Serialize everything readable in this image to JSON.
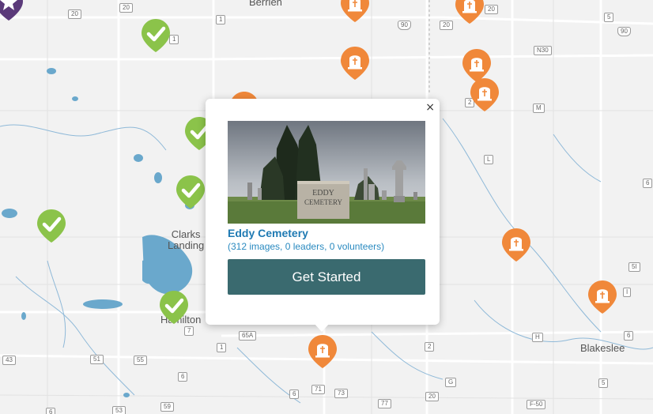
{
  "map": {
    "towns": [
      {
        "id": "berrien",
        "label": "Berrien"
      },
      {
        "id": "clarks-landing",
        "label": "Clarks\nLanding"
      },
      {
        "id": "hamilton",
        "label": "Hamilton"
      },
      {
        "id": "blakeslee",
        "label": "Blakeslee"
      }
    ],
    "road_labels": [
      "20",
      "20",
      "1",
      "20",
      "90",
      "20",
      "5",
      "90",
      "N30",
      "2",
      "M",
      "L",
      "6",
      "I",
      "5I",
      "H",
      "6",
      "7",
      "65A",
      "1",
      "43",
      "51",
      "55",
      "6",
      "71",
      "73",
      "2",
      "G",
      "5",
      "F-50",
      "53",
      "59",
      "77",
      "6"
    ],
    "marker_types": {
      "completed": {
        "icon": "check-icon",
        "color": "#8bc34a"
      },
      "cemetery": {
        "icon": "headstone-icon",
        "color": "#f0883a"
      },
      "featured": {
        "icon": "star-icon",
        "color": "#5b3a7a"
      }
    }
  },
  "popup": {
    "title": "Eddy Cemetery",
    "stats": "(312 images, 0 leaders, 0 volunteers)",
    "button_label": "Get Started",
    "close_symbol": "×",
    "photo_sign": "EDDY\nCEMETERY"
  }
}
